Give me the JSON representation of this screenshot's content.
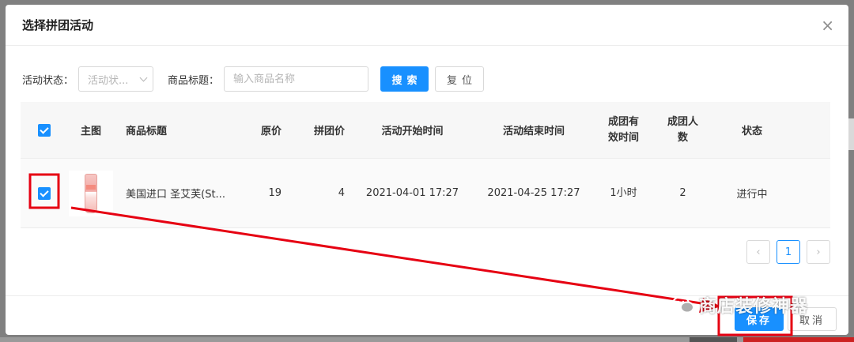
{
  "dialog": {
    "title": "选择拼团活动",
    "close_glyph": "×"
  },
  "filters": {
    "status_label": "活动状态：",
    "status_placeholder": "活动状...",
    "title_label": "商品标题：",
    "title_placeholder": "输入商品名称",
    "search_label": "搜索",
    "reset_label": "复位"
  },
  "table": {
    "headers": {
      "image": "主图",
      "title": "商品标题",
      "price": "原价",
      "group_price": "拼团价",
      "start": "活动开始时间",
      "end": "活动结束时间",
      "valid_line1": "成团有",
      "valid_line2": "效时间",
      "size_line1": "成团人",
      "size_line2": "数",
      "status": "状态"
    },
    "header_checked": true,
    "rows": [
      {
        "checked": true,
        "title": "美国进口 圣艾芙(St...",
        "price": "19",
        "group_price": "4",
        "start": "2021-04-01 17:27",
        "end": "2021-04-25 17:27",
        "valid": "1小时",
        "size": "2",
        "status": "进行中"
      }
    ]
  },
  "pager": {
    "prev": "‹",
    "current": "1",
    "next": "›"
  },
  "footer": {
    "save_label": "保存",
    "cancel_label": "取消"
  },
  "watermark": {
    "text": "商店装修神器"
  },
  "colors": {
    "primary": "#1890ff",
    "annotation": "#e60012"
  }
}
